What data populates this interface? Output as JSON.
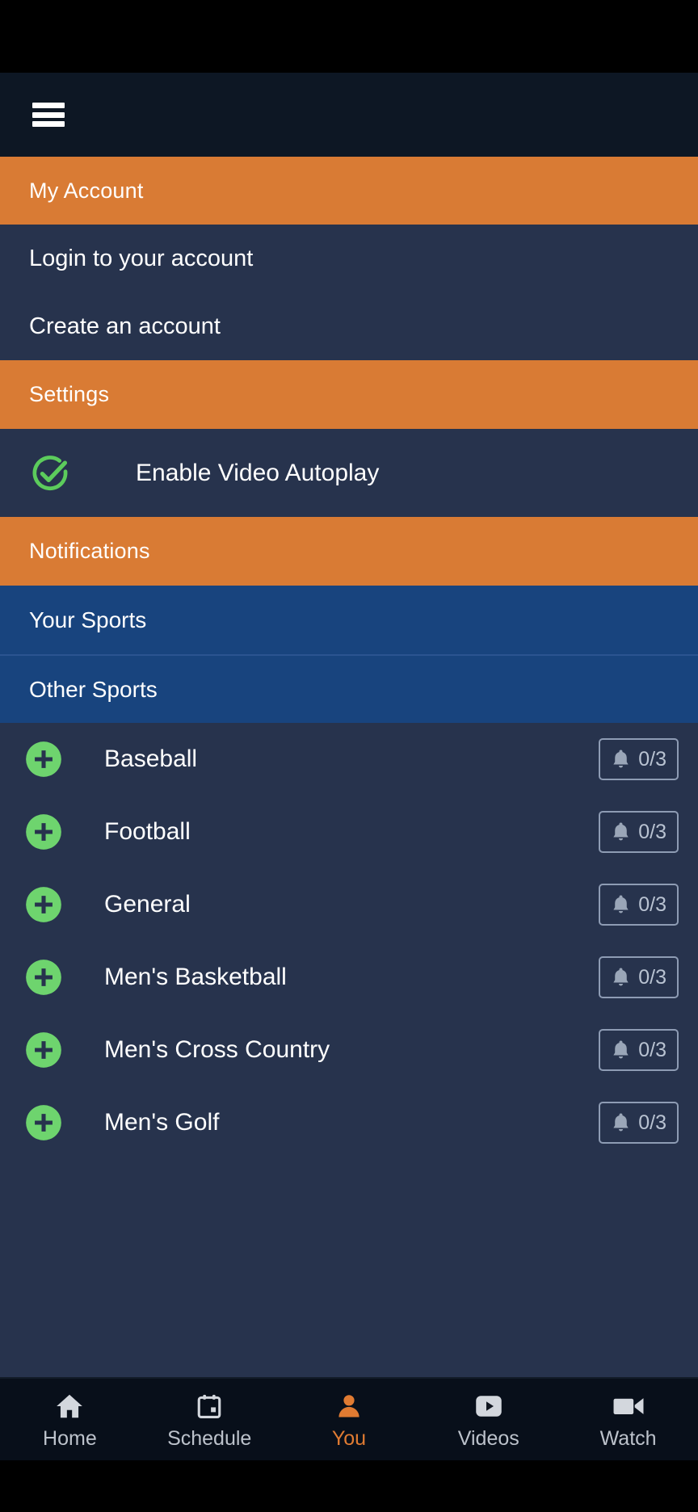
{
  "header": {
    "menu_icon": "hamburger-menu-icon"
  },
  "sections": {
    "my_account": {
      "title": "My Account",
      "items": [
        {
          "label": "Login to your account"
        },
        {
          "label": "Create an account"
        }
      ]
    },
    "settings": {
      "title": "Settings",
      "autoplay": {
        "label": "Enable Video Autoplay",
        "icon": "check-circle-icon",
        "checked": true
      }
    },
    "notifications": {
      "title": "Notifications",
      "groups": [
        {
          "label": "Your Sports"
        },
        {
          "label": "Other Sports"
        }
      ],
      "sports": [
        {
          "name": "Baseball",
          "add_icon": "plus-circle-icon",
          "bell_icon": "bell-icon",
          "count": "0/3"
        },
        {
          "name": "Football",
          "add_icon": "plus-circle-icon",
          "bell_icon": "bell-icon",
          "count": "0/3"
        },
        {
          "name": "General",
          "add_icon": "plus-circle-icon",
          "bell_icon": "bell-icon",
          "count": "0/3"
        },
        {
          "name": "Men's Basketball",
          "add_icon": "plus-circle-icon",
          "bell_icon": "bell-icon",
          "count": "0/3"
        },
        {
          "name": "Men's Cross Country",
          "add_icon": "plus-circle-icon",
          "bell_icon": "bell-icon",
          "count": "0/3"
        },
        {
          "name": "Men's Golf",
          "add_icon": "plus-circle-icon",
          "bell_icon": "bell-icon",
          "count": "0/3"
        }
      ]
    }
  },
  "bottom_nav": {
    "items": [
      {
        "label": "Home",
        "icon": "home-icon",
        "active": false
      },
      {
        "label": "Schedule",
        "icon": "calendar-icon",
        "active": false
      },
      {
        "label": "You",
        "icon": "person-icon",
        "active": true
      },
      {
        "label": "Videos",
        "icon": "play-icon",
        "active": false
      },
      {
        "label": "Watch",
        "icon": "videocam-icon",
        "active": false
      }
    ]
  },
  "colors": {
    "accent_orange": "#d97b34",
    "nav_active_orange": "#e07b32",
    "panel_navy": "#27334d",
    "group_blue": "#18447e",
    "header_dark": "#0d1724",
    "green": "#6ed46e",
    "check_green": "#5ccc5c"
  }
}
